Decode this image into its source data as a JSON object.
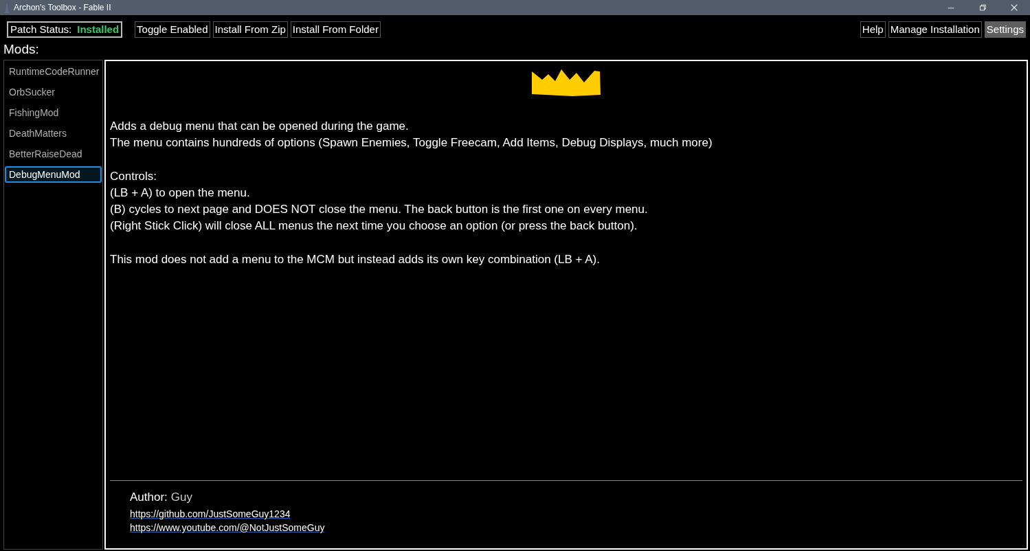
{
  "window": {
    "title": "Archon's Toolbox - Fable II"
  },
  "toolbar": {
    "patch_status": {
      "label": "Patch Status:",
      "value": "Installed"
    },
    "left_buttons": [
      {
        "label": "Toggle Enabled"
      },
      {
        "label": "Install From Zip"
      },
      {
        "label": "Install From Folder"
      }
    ],
    "right_buttons": [
      {
        "label": "Help",
        "highlighted": false
      },
      {
        "label": "Manage Installation",
        "highlighted": false
      },
      {
        "label": "Settings",
        "highlighted": true
      }
    ]
  },
  "mods_heading": "Mods:",
  "sidebar": {
    "items": [
      {
        "label": "RuntimeCodeRunner",
        "selected": false
      },
      {
        "label": "OrbSucker",
        "selected": false
      },
      {
        "label": "FishingMod",
        "selected": false
      },
      {
        "label": "DeathMatters",
        "selected": false
      },
      {
        "label": "BetterRaiseDead",
        "selected": false
      },
      {
        "label": "DebugMenuMod",
        "selected": true
      }
    ]
  },
  "details": {
    "paragraphs": [
      [
        "Adds a debug menu that can be opened during the game.",
        "The menu contains hundreds of options (Spawn Enemies, Toggle Freecam, Add Items, Debug Displays, much more)"
      ],
      [
        "Controls:",
        "(LB + A) to open the menu.",
        "(B) cycles to next page and DOES NOT close the menu. The back button is the first one on every menu.",
        "(Right Stick Click) will close ALL menus the next time you choose an option (or press the back button)."
      ],
      [
        "This mod does not add a menu to the MCM but instead adds its own key combination (LB + A)."
      ]
    ],
    "author_label": "Author:",
    "author": "Guy",
    "links": [
      "https://github.com/JustSomeGuy1234",
      "https://www.youtube.com/@NotJustSomeGuy"
    ]
  }
}
